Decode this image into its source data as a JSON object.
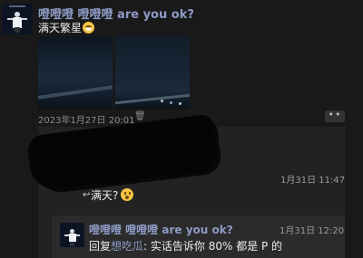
{
  "post": {
    "author": "噔噔噔 噔噔噔 are you ok?",
    "text": "满天繁星",
    "emoji": "grin-emoji",
    "photos": [
      "night-sky-photo-1",
      "night-sky-photo-2"
    ],
    "date": "2023年1月27日 20:01",
    "more_label": "••"
  },
  "comments": {
    "first_time": "1月31日 11:47",
    "reply_prefix": "↩",
    "reply_text": "满天?",
    "reply_emoji": "surprised-emoji",
    "quoted": {
      "author": "噔噔噔 噔噔噔 are you ok?",
      "time": "1月31日 12:20",
      "reply_label": "回复",
      "reply_target": "想吃瓜",
      "message": ": 实话告诉你 80% 都是 P 的"
    }
  },
  "colors": {
    "background": "#191919",
    "nickname": "#8d9ac4",
    "panel": "#222222"
  }
}
